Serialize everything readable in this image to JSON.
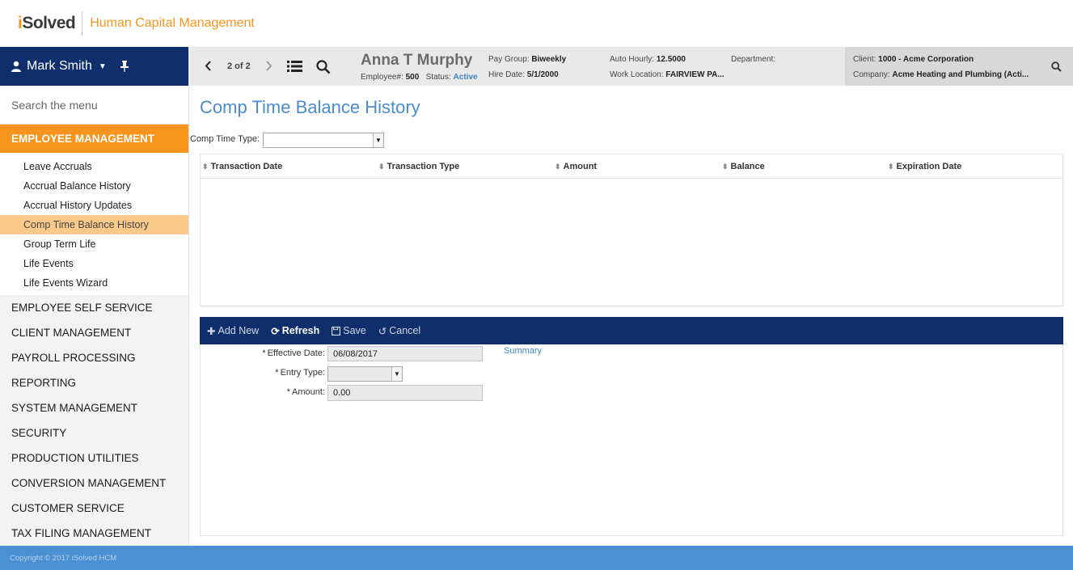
{
  "brand": {
    "logo_prefix": "i",
    "logo_rest": "Solved",
    "title": "Human Capital Management"
  },
  "user": {
    "name": "Mark Smith"
  },
  "menu": {
    "search_placeholder": "Search the menu",
    "active_section": "EMPLOYEE MANAGEMENT",
    "sub_items": [
      {
        "label": "Leave Accruals"
      },
      {
        "label": "Accrual Balance History"
      },
      {
        "label": "Accrual History Updates"
      },
      {
        "label": "Comp Time Balance History"
      },
      {
        "label": "Group Term Life"
      },
      {
        "label": "Life Events"
      },
      {
        "label": "Life Events Wizard"
      }
    ],
    "selected_index": 3,
    "sections": [
      {
        "label": "EMPLOYEE SELF SERVICE"
      },
      {
        "label": "CLIENT MANAGEMENT"
      },
      {
        "label": "PAYROLL PROCESSING"
      },
      {
        "label": "REPORTING"
      },
      {
        "label": "SYSTEM MANAGEMENT"
      },
      {
        "label": "SECURITY"
      },
      {
        "label": "PRODUCTION UTILITIES"
      },
      {
        "label": "CONVERSION MANAGEMENT"
      },
      {
        "label": "CUSTOMER SERVICE"
      },
      {
        "label": "TAX FILING MANAGEMENT"
      }
    ]
  },
  "employee": {
    "pager": "2 of 2",
    "name": "Anna T Murphy",
    "employee_label": "Employee#:",
    "employee_number": "500",
    "status_label": "Status:",
    "status_value": "Active",
    "pay_group_label": "Pay Group:",
    "pay_group_value": "Biweekly",
    "hire_date_label": "Hire Date:",
    "hire_date_value": "5/1/2000",
    "auto_hourly_label": "Auto Hourly:",
    "auto_hourly_value": "12.5000",
    "work_location_label": "Work Location:",
    "work_location_value": "FAIRVIEW PA...",
    "department_label": "Department:",
    "client_label": "Client:",
    "client_value": "1000 - Acme Corporation",
    "company_label": "Company:",
    "company_value": "Acme Heating and Plumbing (Acti..."
  },
  "page": {
    "title": "Comp Time Balance History",
    "comp_time_type_label": "Comp Time Type:",
    "comp_time_type_value": "",
    "columns": [
      "Transaction Date",
      "Transaction Type",
      "Amount",
      "Balance",
      "Expiration Date"
    ]
  },
  "toolbar": {
    "add_new": "Add New",
    "refresh": "Refresh",
    "save": "Save",
    "cancel": "Cancel"
  },
  "form": {
    "effective_date_label": "Effective Date:",
    "effective_date_value": "06/08/2017",
    "entry_type_label": "Entry Type:",
    "entry_type_value": "",
    "amount_label": "Amount:",
    "amount_value": "0.00",
    "required_mark": "*",
    "summary_link": "Summary"
  },
  "footer": {
    "copyright": "Copyright © 2017 iSolved HCM"
  },
  "colors": {
    "navy": "#0e2f6b",
    "orange": "#f7941d",
    "selected_orange": "#fbc98a",
    "link_blue": "#4a8ccf",
    "footer_blue": "#4a90d2"
  }
}
